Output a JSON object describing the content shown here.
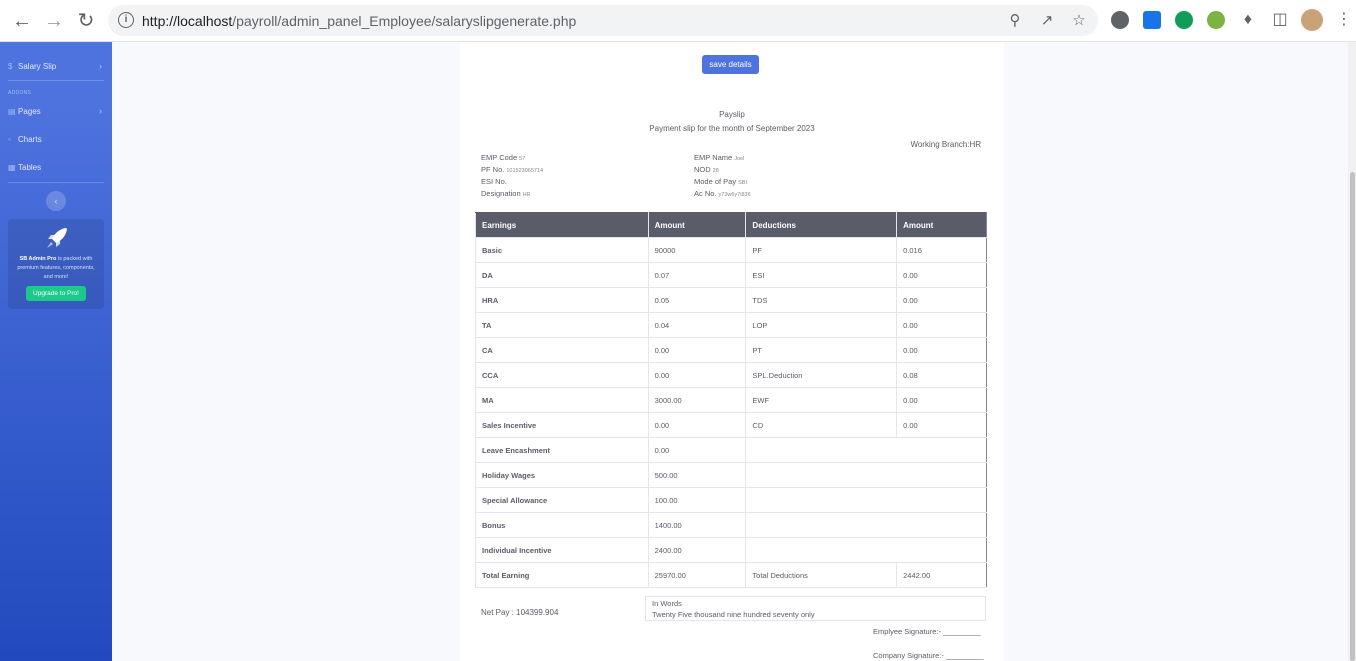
{
  "browser": {
    "url_host": "http://localhost",
    "url_path": "/payroll/admin_panel_Employee/salaryslipgenerate.php"
  },
  "sidebar": {
    "salary_slip": "Salary Slip",
    "heading_addons": "ADDONS",
    "pages": "Pages",
    "charts": "Charts",
    "tables": "Tables",
    "promo_bold": "SB Admin Pro",
    "promo_text": " is packed with premium features, components, and more!",
    "upgrade_label": "Upgrade to Pro!"
  },
  "actions": {
    "save_label": "save details"
  },
  "payslip": {
    "title": "Payslip",
    "subtitle": "Payment slip for the month of September 2023",
    "working_branch": "Working Branch:HR",
    "emp_code_label": "EMP Code",
    "emp_code": "57",
    "pf_no_label": "PF No.",
    "pf_no": "101523065714",
    "esi_no_label": "ESI No.",
    "esi_no": "",
    "designation_label": "Designation",
    "designation": "HR",
    "emp_name_label": "EMP Name",
    "emp_name": "Joel",
    "nod_label": "NOD",
    "nod": "28",
    "mode_of_pay_label": "Mode of Pay",
    "mode_of_pay": "SBI",
    "ac_no_label": "Ac No.",
    "ac_no": "y73w6y7i836"
  },
  "table": {
    "headers": [
      "Earnings",
      "Amount",
      "Deductions",
      "Amount"
    ],
    "rows": [
      [
        "Basic",
        "90000",
        "PF",
        "0.016"
      ],
      [
        "DA",
        "0.07",
        "ESI",
        "0.00"
      ],
      [
        "HRA",
        "0.05",
        "TDS",
        "0.00"
      ],
      [
        "TA",
        "0.04",
        "LOP",
        "0.00"
      ],
      [
        "CA",
        "0.00",
        "PT",
        "0.00"
      ],
      [
        "CCA",
        "0.00",
        "SPL.Deduction",
        "0.08"
      ],
      [
        "MA",
        "3000.00",
        "EWF",
        "0.00"
      ],
      [
        "Sales Incentive",
        "0.00",
        "CD",
        "0.00"
      ],
      [
        "Leave Encashment",
        "0.00",
        "",
        ""
      ],
      [
        "Holiday Wages",
        "500.00",
        "",
        ""
      ],
      [
        "Special Allowance",
        "100.00",
        "",
        ""
      ],
      [
        "Bonus",
        "1400.00",
        "",
        ""
      ],
      [
        "Individual Incentive",
        "2400.00",
        "",
        ""
      ]
    ],
    "total_earning_label": "Total Earning",
    "total_earning": "25970.00",
    "total_deductions_label": "Total Deductions",
    "total_deductions": "2442.00"
  },
  "footer": {
    "net_pay": "Net Pay : 104399.904",
    "in_words_label": "In Words",
    "in_words": "Twenty Five thousand nine hundred seventy only",
    "employee_signature": "Emplyee Signature:- _________",
    "company_signature": "Company Signature:- _________"
  }
}
